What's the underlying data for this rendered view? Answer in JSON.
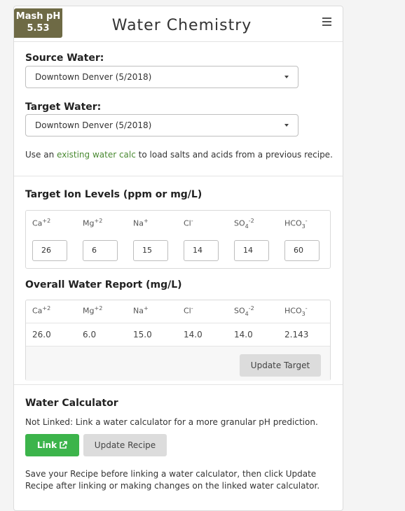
{
  "header": {
    "mash_ph_label": "Mash pH",
    "mash_ph_value": "5.53",
    "title": "Water Chemistry",
    "menu_icon": "hamburger-menu-icon"
  },
  "source_water": {
    "label": "Source Water:",
    "selected": "Downtown Denver (5/2018)"
  },
  "target_water": {
    "label": "Target Water:",
    "selected": "Downtown Denver (5/2018)"
  },
  "existing_calc": {
    "prefix": "Use an ",
    "link": "existing water calc",
    "suffix": " to load salts and acids from a previous recipe."
  },
  "target_ions": {
    "heading": "Target Ion Levels (ppm or mg/L)",
    "ions": [
      {
        "base": "Ca",
        "sup": "+2",
        "sub": "",
        "value": "26"
      },
      {
        "base": "Mg",
        "sup": "+2",
        "sub": "",
        "value": "6"
      },
      {
        "base": "Na",
        "sup": "+",
        "sub": "",
        "value": "15"
      },
      {
        "base": "Cl",
        "sup": "-",
        "sub": "",
        "value": "14"
      },
      {
        "base": "SO",
        "sup": "-2",
        "sub": "4",
        "value": "14"
      },
      {
        "base": "HCO",
        "sup": "-",
        "sub": "3",
        "value": "60"
      }
    ]
  },
  "report": {
    "heading": "Overall Water Report (mg/L)",
    "values": [
      "26.0",
      "6.0",
      "15.0",
      "14.0",
      "14.0",
      "2.143"
    ],
    "update_target_label": "Update Target"
  },
  "water_calculator": {
    "heading": "Water Calculator",
    "status_text": "Not Linked: Link a water calculator for a more granular pH prediction.",
    "link_label": "Link",
    "link_icon": "external-link-icon",
    "update_recipe_label": "Update Recipe",
    "footer_text": "Save your Recipe before linking a water calculator, then click Update Recipe after linking or making changes on the linked water calculator."
  },
  "colors": {
    "mash_badge": "#6e6a45",
    "link_green": "#4a8a32",
    "link_button": "#3cb44b",
    "gray_button": "#dcdcdc"
  }
}
